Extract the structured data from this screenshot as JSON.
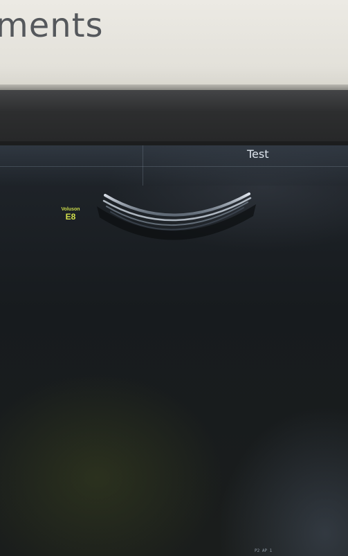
{
  "wall_sign": {
    "text": "ments"
  },
  "screen": {
    "title": "Test",
    "device_brand": "Voluson",
    "device_model": "E8",
    "corner_readout": "P2 AP 1"
  }
}
